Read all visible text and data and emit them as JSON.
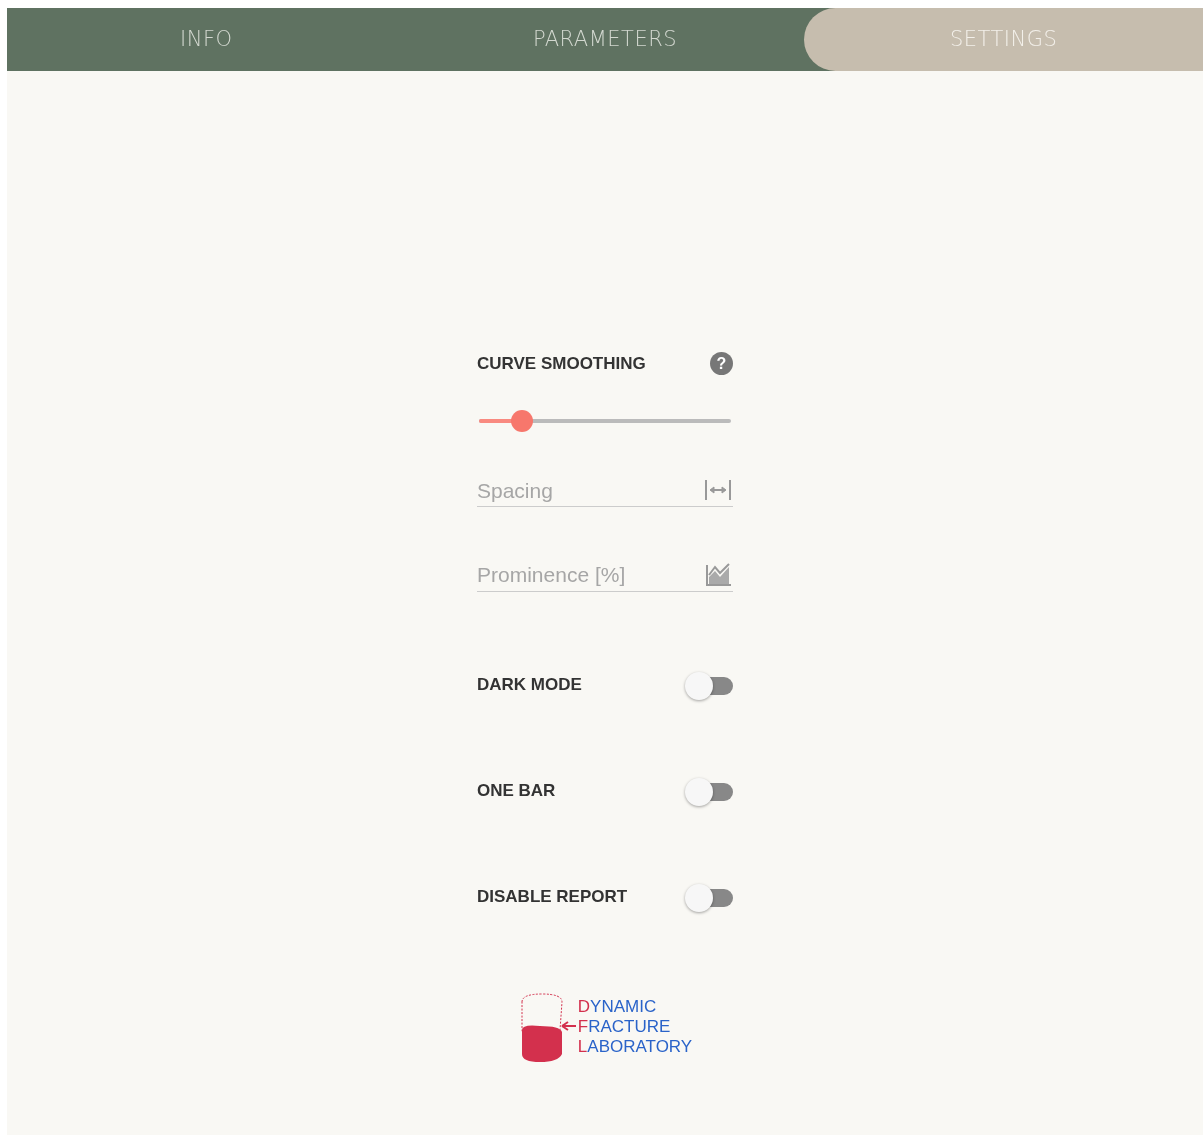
{
  "tabs": [
    {
      "label": "INFO",
      "selected": false
    },
    {
      "label": "PARAMETERS",
      "selected": false
    },
    {
      "label": "SETTINGS",
      "selected": true
    }
  ],
  "smoothing": {
    "label": "CURVE SMOOTHING",
    "help": "?",
    "level": 0.17
  },
  "fields": [
    {
      "placeholder": "Spacing",
      "kind": "spacing"
    },
    {
      "placeholder": "Prominence [%]",
      "kind": "chart"
    }
  ],
  "toggles": [
    {
      "label": "DARK MODE",
      "on": false
    },
    {
      "label": "ONE BAR",
      "on": false
    },
    {
      "label": "DISABLE REPORT",
      "on": false
    }
  ],
  "logo": {
    "lines": [
      {
        "initial": "D",
        "rest": "YNAMIC"
      },
      {
        "initial": "F",
        "rest": "RACTURE"
      },
      {
        "initial": "L",
        "rest": "ABORATORY"
      }
    ]
  }
}
